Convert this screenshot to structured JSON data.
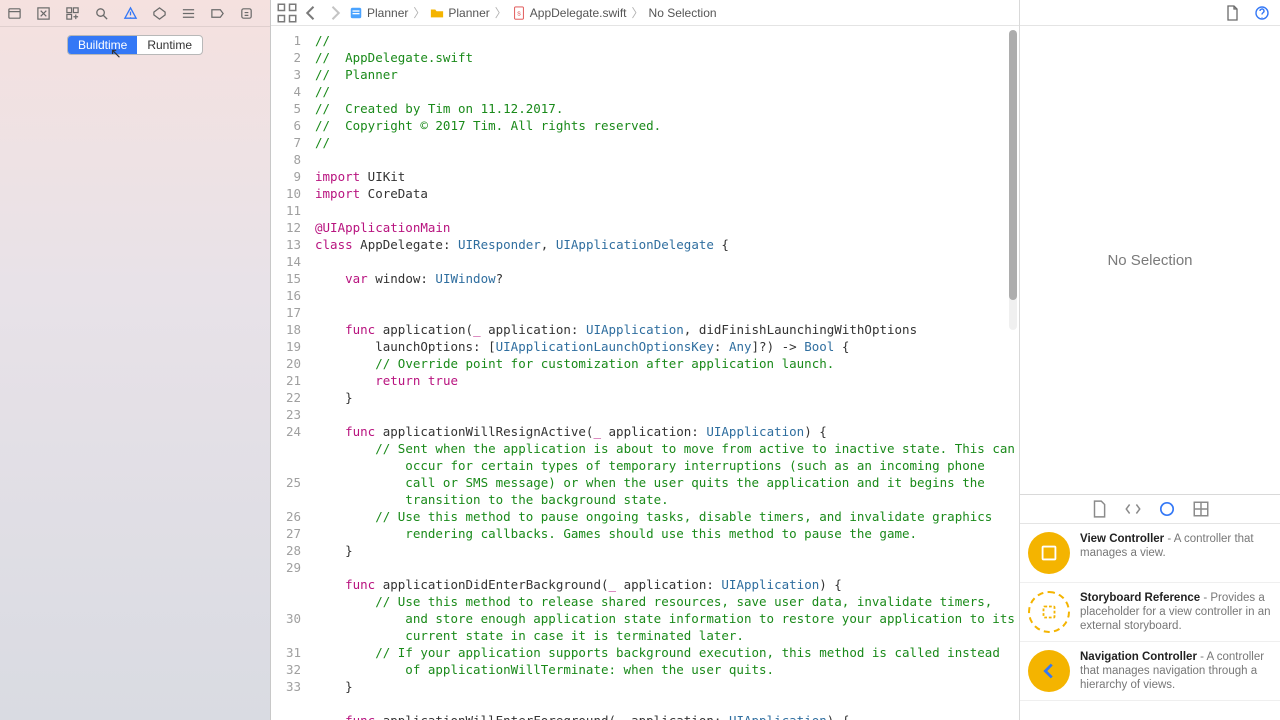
{
  "navigator": {
    "tabs": {
      "buildtime": "Buildtime",
      "runtime": "Runtime"
    }
  },
  "jumpbar": {
    "project": "Planner",
    "group": "Planner",
    "file": "AppDelegate.swift",
    "selection": "No Selection"
  },
  "inspector": {
    "empty_label": "No Selection"
  },
  "library": [
    {
      "title": "View Controller",
      "desc": " - A controller that manages a view.",
      "icon": "rect-solid"
    },
    {
      "title": "Storyboard Reference",
      "desc": " - Provides a placeholder for a view controller in an external storyboard.",
      "icon": "rect-dashed"
    },
    {
      "title": "Navigation Controller",
      "desc": " - A controller that manages navigation through a hierarchy of views.",
      "icon": "back-arrow"
    }
  ],
  "code": {
    "line_numbers": [
      1,
      2,
      3,
      4,
      5,
      6,
      7,
      8,
      9,
      10,
      11,
      12,
      13,
      14,
      15,
      16,
      17,
      18,
      19,
      20,
      21,
      22,
      23,
      24,
      25,
      26,
      27,
      28,
      29,
      30,
      31,
      32,
      33
    ]
  }
}
